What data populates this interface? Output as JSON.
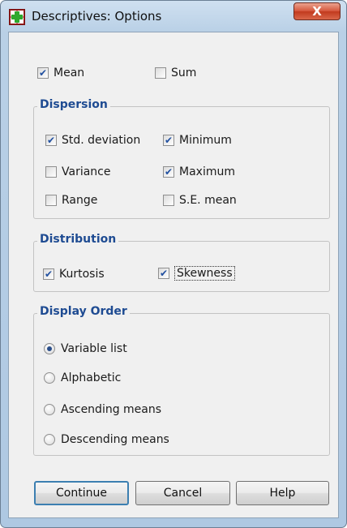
{
  "window": {
    "title": "Descriptives: Options",
    "close_label": "X"
  },
  "top": {
    "mean": {
      "label": "Mean",
      "checked": true
    },
    "sum": {
      "label": "Sum",
      "checked": false
    }
  },
  "dispersion": {
    "title": "Dispersion",
    "std_deviation": {
      "label": "Std. deviation",
      "checked": true
    },
    "minimum": {
      "label": "Minimum",
      "checked": true
    },
    "variance": {
      "label": "Variance",
      "checked": false
    },
    "maximum": {
      "label": "Maximum",
      "checked": true
    },
    "range": {
      "label": "Range",
      "checked": false
    },
    "se_mean": {
      "label": "S.E. mean",
      "checked": false
    }
  },
  "distribution": {
    "title": "Distribution",
    "kurtosis": {
      "label": "Kurtosis",
      "checked": true
    },
    "skewness": {
      "label": "Skewness",
      "checked": true
    }
  },
  "display_order": {
    "title": "Display Order",
    "options": [
      "Variable list",
      "Alphabetic",
      "Ascending means",
      "Descending means"
    ],
    "selected": "Variable list"
  },
  "buttons": {
    "continue": "Continue",
    "cancel": "Cancel",
    "help": "Help"
  },
  "colors": {
    "group_title": "#1e4b92",
    "check_mark": "#2150a0",
    "close_button": "#c23a1e"
  }
}
